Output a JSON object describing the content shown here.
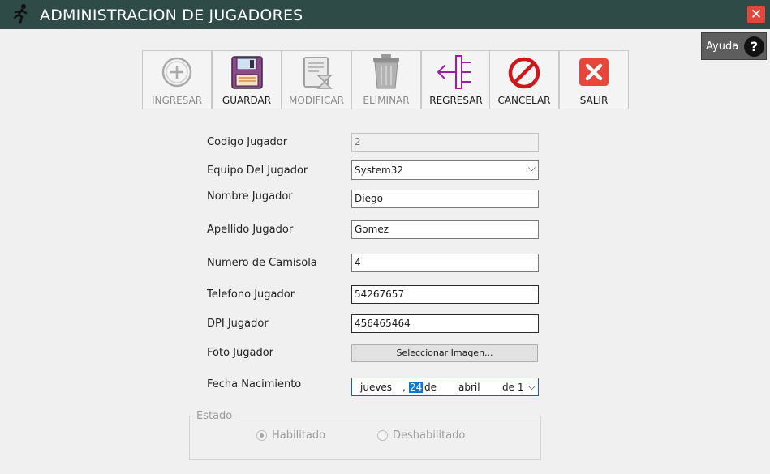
{
  "window": {
    "title": "ADMINISTRACION DE JUGADORES",
    "close_symbol": "✕",
    "app_icon": "running-player-icon"
  },
  "help": {
    "label": "Ayuda",
    "icon_symbol": "?"
  },
  "toolbar": {
    "ingresar": {
      "label": "INGRESAR",
      "icon": "plus-circle-icon",
      "enabled": false
    },
    "guardar": {
      "label": "GUARDAR",
      "icon": "floppy-disk-icon",
      "enabled": true
    },
    "modificar": {
      "label": "MODIFICAR",
      "icon": "document-hourglass-icon",
      "enabled": false
    },
    "eliminar": {
      "label": "ELIMINAR",
      "icon": "trash-can-icon",
      "enabled": false
    },
    "regresar": {
      "label": "REGRESAR",
      "icon": "back-arrow-icon",
      "enabled": true
    },
    "cancelar": {
      "label": "CANCELAR",
      "icon": "prohibited-icon",
      "enabled": true
    },
    "salir": {
      "label": "SALIR",
      "icon": "exit-x-icon",
      "enabled": true
    }
  },
  "form": {
    "codigo": {
      "label": "Codigo Jugador",
      "value": "2"
    },
    "equipo": {
      "label": "Equipo Del Jugador",
      "value": "System32"
    },
    "nombre": {
      "label": "Nombre Jugador",
      "value": "Diego"
    },
    "apellido": {
      "label": "Apellido Jugador",
      "value": "Gomez"
    },
    "camisola": {
      "label": "Numero de Camisola",
      "value": "4"
    },
    "telefono": {
      "label": "Telefono Jugador",
      "value": "54267657"
    },
    "dpi": {
      "label": "DPI Jugador",
      "value": "456465464"
    },
    "foto": {
      "label": "Foto Jugador",
      "button": "Seleccionar Imagen..."
    },
    "fecha": {
      "label": "Fecha Nacimiento",
      "weekday": "jueves",
      "comma": ",",
      "day": "24",
      "de1": "de",
      "month": "abril",
      "de2": "de 1"
    },
    "estado": {
      "title": "Estado",
      "options": [
        {
          "label": "Habilitado",
          "selected": true
        },
        {
          "label": "Deshabilitado",
          "selected": false
        }
      ]
    }
  },
  "colors": {
    "titlebar": "#2e4b47",
    "close": "#e3463b",
    "accent_purple": "#a01aa8",
    "cancel_red": "#d0161b",
    "salir_red": "#e8463a"
  }
}
